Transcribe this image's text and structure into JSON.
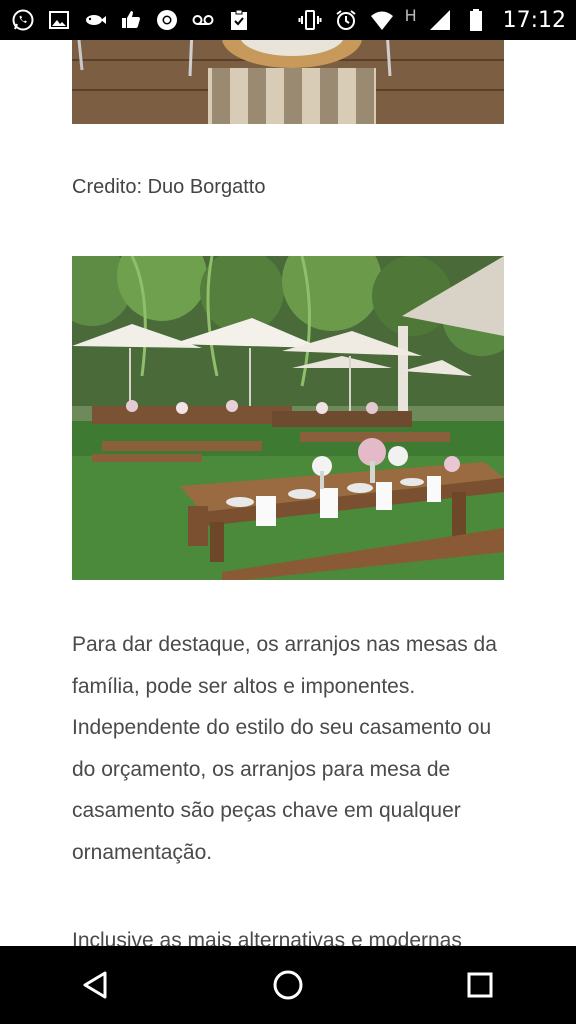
{
  "status_bar": {
    "left_icons": [
      "whatsapp-icon",
      "image-icon",
      "fish-icon",
      "thumbs-up-icon",
      "chrome-icon",
      "voicemail-icon",
      "clipboard-check-icon"
    ],
    "right_icons": [
      "vibrate-icon",
      "alarm-icon",
      "wifi-icon",
      "signal-icon",
      "battery-icon"
    ],
    "network_label": "H",
    "time": "17:12"
  },
  "article": {
    "caption": "Credito: Duo Borgatto",
    "paragraph_1": "Para dar destaque, os arranjos nas mesas da família, pode ser altos e imponentes. Independente do estilo do seu casamento ou do orçamento, os arranjos para mesa de casamento são peças chave em qualquer ornamentação.",
    "paragraph_2": "Inclusive as mais alternativas e modernas"
  },
  "nav_bar": {
    "buttons": [
      "back-icon",
      "home-icon",
      "recents-icon"
    ]
  }
}
